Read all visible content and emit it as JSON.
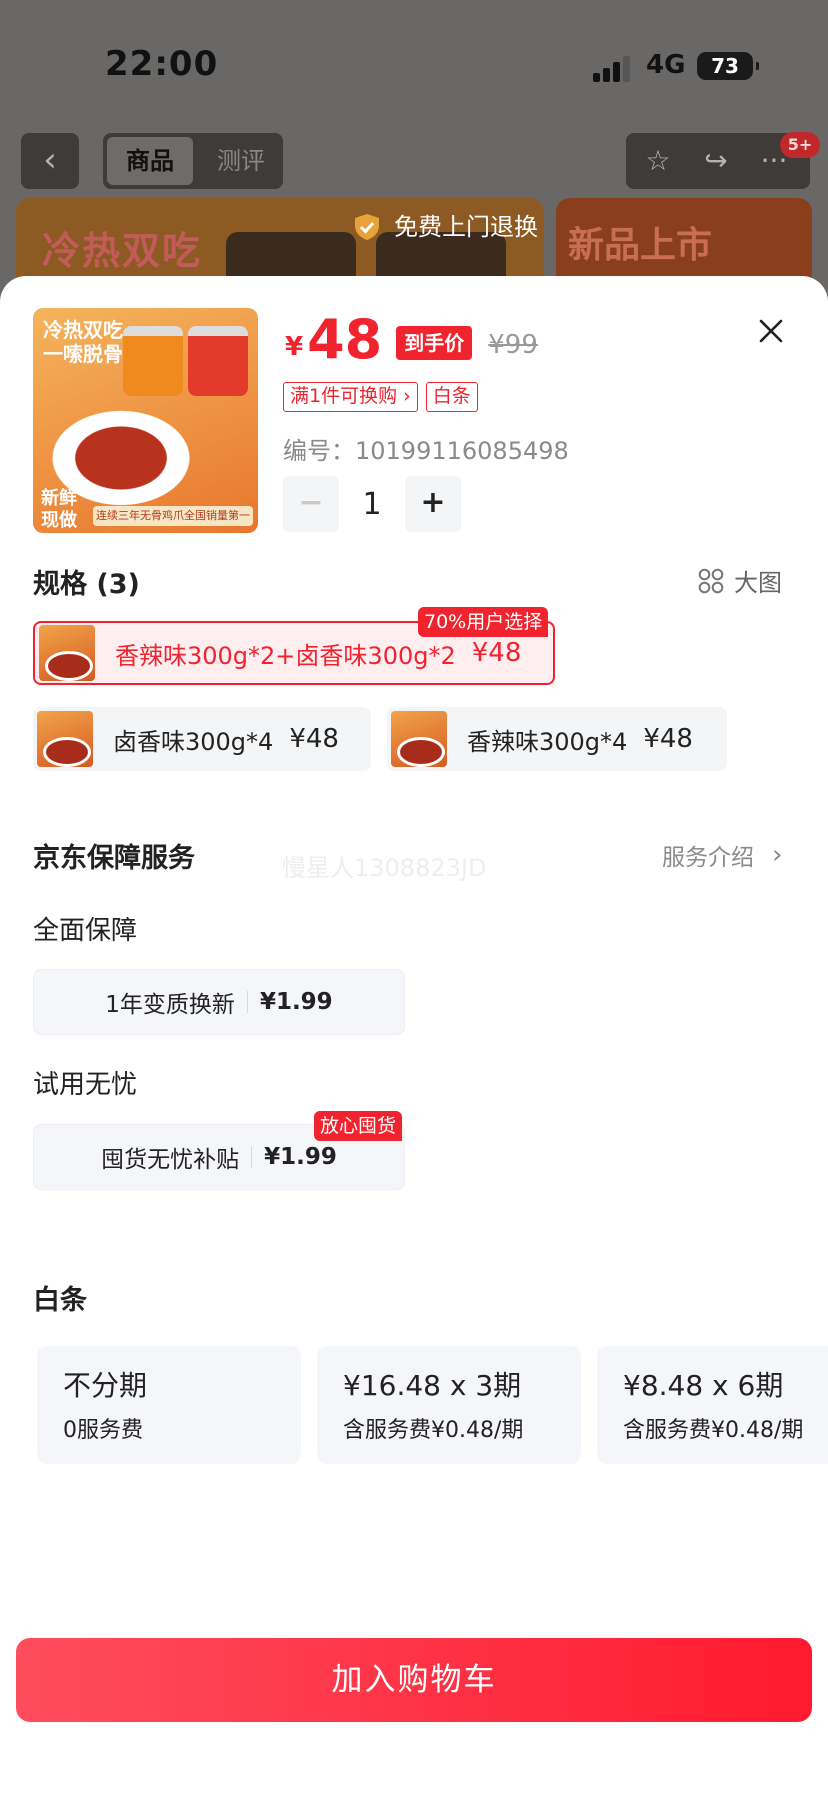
{
  "status_bar": {
    "time": "22:00",
    "network": "4G",
    "battery": "73"
  },
  "nav": {
    "tabs": [
      "商品",
      "测评"
    ],
    "badge": "5+"
  },
  "banners": {
    "left_title": "冷热双吃",
    "right_title": "新品上市"
  },
  "return_pill": {
    "label": "免费上门退换"
  },
  "product": {
    "image_text": {
      "headline": "冷热双吃\n一嗦脱骨",
      "fresh": "新鲜\n现做",
      "strip": "连续三年无骨鸡爪全国销量第一"
    },
    "currency": "¥",
    "price": "48",
    "price_tag": "到手价",
    "original_price": "¥99",
    "promos": [
      "满1件可换购 ›",
      "白条"
    ],
    "sku_label": "编号：",
    "sku_number": "10199116085498",
    "quantity": "1",
    "minus": "−",
    "plus": "+"
  },
  "specs": {
    "title": "规格 (3)",
    "big_image": "大图",
    "selected_badge": "70%用户选择",
    "options": [
      {
        "label": "香辣味300g*2+卤香味300g*2",
        "price": "¥48"
      },
      {
        "label": "卤香味300g*4",
        "price": "¥48"
      },
      {
        "label": "香辣味300g*4",
        "price": "¥48"
      }
    ]
  },
  "services": {
    "title": "京东保障服务",
    "intro": "服务介绍",
    "watermark": "慢星人1308823JD",
    "groups": [
      {
        "title": "全面保障",
        "item": "1年变质换新",
        "price": "¥1.99"
      },
      {
        "title": "试用无忧",
        "item": "囤货无忧补贴",
        "price": "¥1.99",
        "badge": "放心囤货"
      }
    ]
  },
  "baitiao": {
    "title": "白条",
    "plans": [
      {
        "line1": "不分期",
        "line2": "0服务费"
      },
      {
        "line1": "¥16.48 x 3期",
        "line2": "含服务费¥0.48/期"
      },
      {
        "line1": "¥8.48 x 6期",
        "line2": "含服务费¥0.48/期"
      }
    ]
  },
  "cart": {
    "label": "加入购物车"
  },
  "colors": {
    "accent": "#f0232e",
    "cart_start": "#fe4d5d",
    "cart_end": "#ff1a2f"
  },
  "icons": [
    "back-icon",
    "star-icon",
    "share-icon",
    "more-icon",
    "shield-check-icon",
    "close-icon",
    "grid-icon",
    "chevron-right-icon"
  ]
}
